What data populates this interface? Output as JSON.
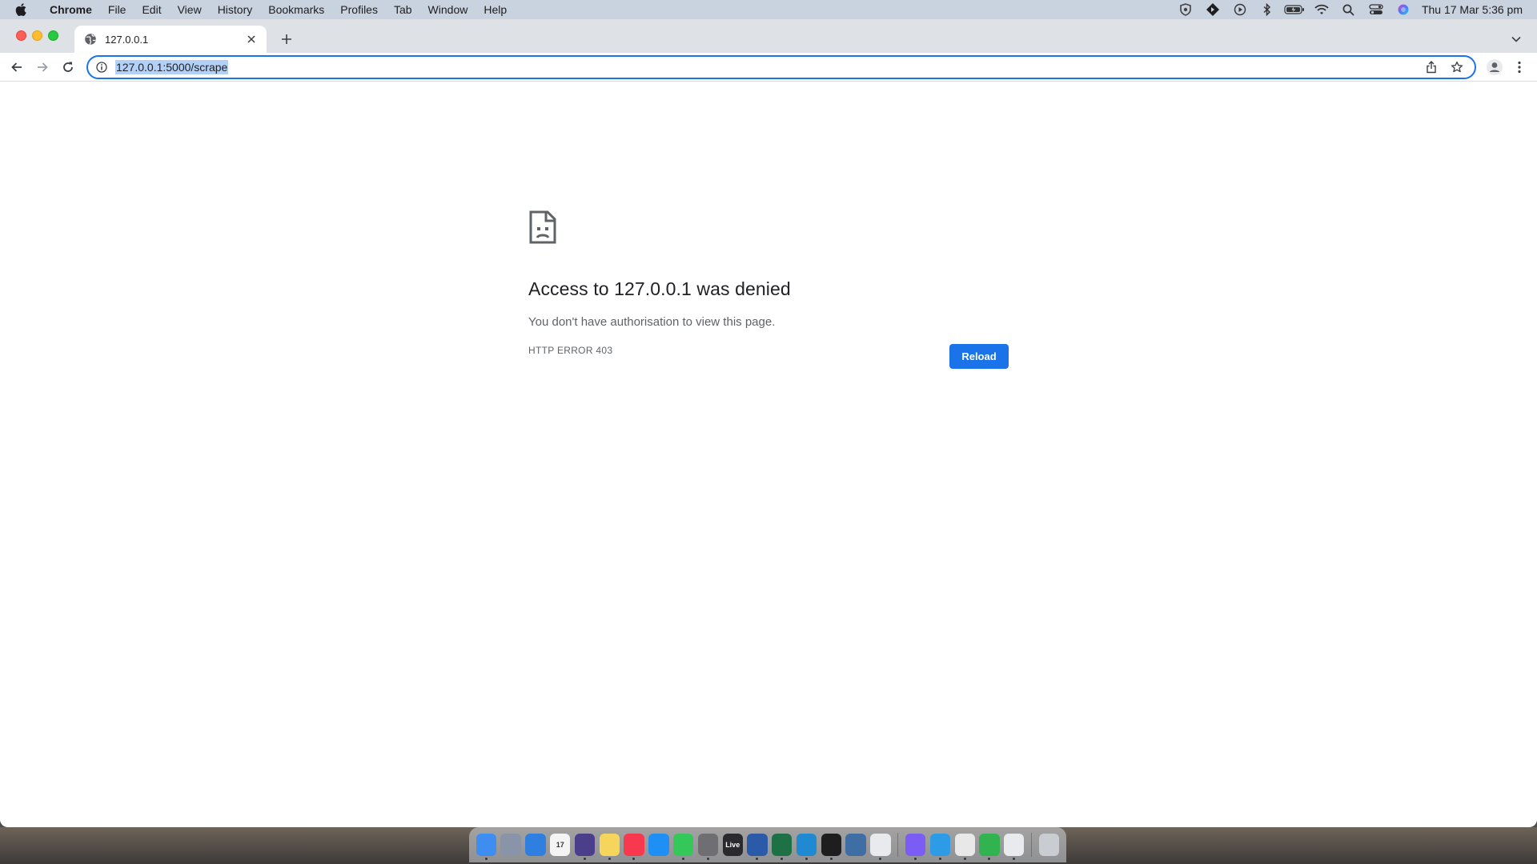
{
  "menubar": {
    "app_name": "Chrome",
    "items": [
      "File",
      "Edit",
      "View",
      "History",
      "Bookmarks",
      "Profiles",
      "Tab",
      "Window",
      "Help"
    ],
    "clock": "Thu 17 Mar  5:36 pm",
    "status_icons": [
      "shield-icon",
      "diamond-app-icon",
      "play-icon",
      "bluetooth-icon",
      "battery-icon",
      "wifi-icon",
      "spotlight-search-icon",
      "control-center-icon",
      "siri-icon"
    ]
  },
  "tab": {
    "title": "127.0.0.1",
    "favicon": "globe-icon"
  },
  "omnibox": {
    "url": "127.0.0.1:5000/scrape"
  },
  "error": {
    "heading": "Access to 127.0.0.1 was denied",
    "message": "You don't have authorisation to view this page.",
    "code": "HTTP ERROR 403",
    "reload_label": "Reload"
  },
  "dock": {
    "apps": [
      {
        "name": "finder",
        "color": "#3d8ef0"
      },
      {
        "name": "launchpad",
        "color": "#8a94a8"
      },
      {
        "name": "safari",
        "color": "#2f7fe0"
      },
      {
        "name": "calendar",
        "color": "#f4f4f4",
        "label": "17"
      },
      {
        "name": "diamond-app",
        "color": "#4b3f8c"
      },
      {
        "name": "notes",
        "color": "#f6d55c"
      },
      {
        "name": "music",
        "color": "#f8384f"
      },
      {
        "name": "app-store",
        "color": "#1d8ff5"
      },
      {
        "name": "messages",
        "color": "#34c759"
      },
      {
        "name": "system-preferences",
        "color": "#6e6e73"
      },
      {
        "name": "live",
        "color": "#2a2a2e",
        "label": "Live"
      },
      {
        "name": "word",
        "color": "#2b5aa8"
      },
      {
        "name": "excel",
        "color": "#1e7145"
      },
      {
        "name": "vscode",
        "color": "#1f8ad2"
      },
      {
        "name": "terminal",
        "color": "#1e1e1e"
      },
      {
        "name": "pgadmin",
        "color": "#3f6ea5"
      },
      {
        "name": "chrome",
        "color": "#e8eaed"
      },
      {
        "name": "messenger",
        "color": "#7b5cf5"
      },
      {
        "name": "edge",
        "color": "#2d9be6"
      },
      {
        "name": "slack",
        "color": "#e8e8e8"
      },
      {
        "name": "numbers",
        "color": "#31b34f"
      },
      {
        "name": "chrome-2",
        "color": "#e8eaed"
      },
      {
        "name": "trash",
        "color": "#c9cdd2"
      }
    ]
  }
}
